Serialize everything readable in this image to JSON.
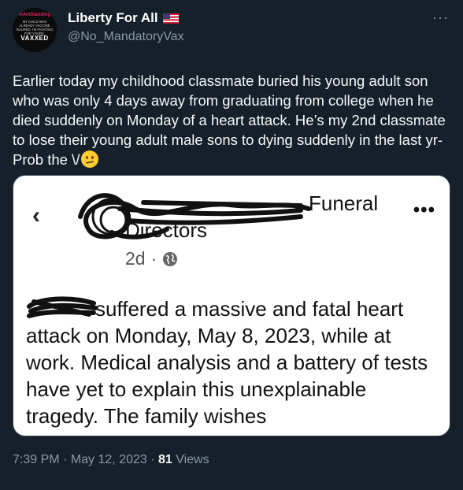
{
  "profile": {
    "display_name": "Liberty For All",
    "flag_icon": "us-flag-icon",
    "handle": "@No_MandatoryVax",
    "avatar": {
      "hashtag": "#IAmStanding",
      "line1": "MY CHILD WAS ALREADY VACCINE INJURED.",
      "line2": "I'M FIGHTING FOR YOURS.",
      "badge": "VAXXED"
    }
  },
  "tweet": {
    "text": "Earlier today my childhood classmate buried his young adult son who was only 4 days away from graduating from college when he died suddenly on Monday of a heart attack. He’s my 2nd classmate to lose their young adult male sons to dying suddenly in the last yr-Prob the \\/",
    "emoji": "confused-face-emoji"
  },
  "media": {
    "title_fragment": "Funeral",
    "subtitle": "Directors",
    "time_ago": "2d",
    "separator": "·",
    "body": "suffered a massive and fatal heart attack on Monday, May 8, 2023, while at work.  Medical analysis and a battery of tests have yet to explain this unexplainable tragedy.  The family wishes"
  },
  "footer": {
    "time": "7:39 PM",
    "sep1": "·",
    "date": "May 12, 2023",
    "sep2": "·",
    "views_count": "81",
    "views_label": "Views"
  },
  "colors": {
    "background": "#15202b",
    "secondary_text": "#8b98a5",
    "primary_text": "#f7f9f9"
  }
}
